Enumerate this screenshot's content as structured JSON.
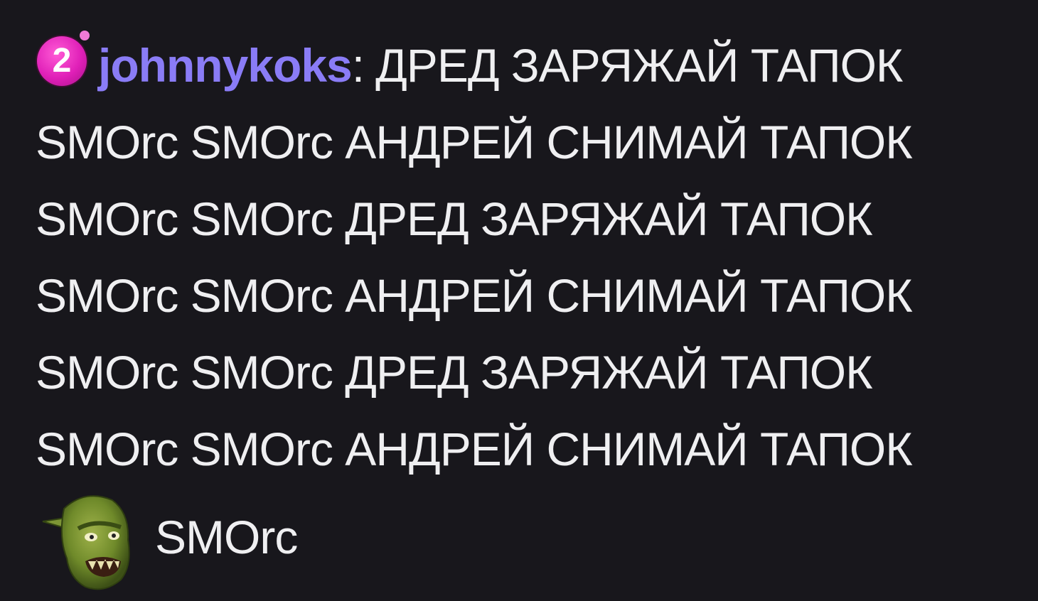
{
  "chat": {
    "badge_count": "2",
    "username": "johnnykoks",
    "colon": ":",
    "lines": [
      "ДРЕД ЗАРЯЖАЙ ТАПОК",
      "SMOrc SMOrc АНДРЕЙ СНИМАЙ ТАПОК",
      "SMOrc SMOrc ДРЕД ЗАРЯЖАЙ ТАПОК",
      "SMOrc SMOrc АНДРЕЙ СНИМАЙ ТАПОК",
      "SMOrc SMOrc ДРЕД ЗАРЯЖАЙ ТАПОК",
      "SMOrc SMOrc АНДРЕЙ СНИМАЙ ТАПОК"
    ],
    "emote_label": "SMOrc",
    "colors": {
      "background": "#18171c",
      "username": "#8a7cf6",
      "text": "#efeff1",
      "badge": "#e020b8"
    }
  }
}
